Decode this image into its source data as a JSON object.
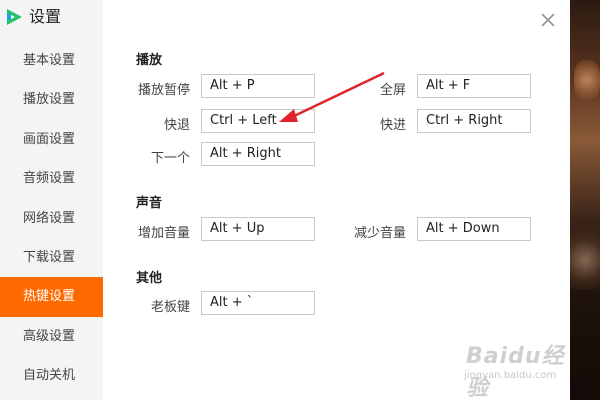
{
  "app": {
    "title": "设置"
  },
  "sidebar": {
    "items": [
      {
        "label": "基本设置",
        "active": false
      },
      {
        "label": "播放设置",
        "active": false
      },
      {
        "label": "画面设置",
        "active": false
      },
      {
        "label": "音频设置",
        "active": false
      },
      {
        "label": "网络设置",
        "active": false
      },
      {
        "label": "下载设置",
        "active": false
      },
      {
        "label": "热键设置",
        "active": true
      },
      {
        "label": "高级设置",
        "active": false
      },
      {
        "label": "自动关机",
        "active": false
      }
    ]
  },
  "sections": {
    "playback": {
      "title": "播放",
      "play_pause": {
        "label": "播放暂停",
        "value": "Alt + P"
      },
      "fullscreen": {
        "label": "全屏",
        "value": "Alt + F"
      },
      "rewind": {
        "label": "快退",
        "value": "Ctrl + Left"
      },
      "forward": {
        "label": "快进",
        "value": "Ctrl + Right"
      },
      "next": {
        "label": "下一个",
        "value": "Alt + Right"
      }
    },
    "sound": {
      "title": "声音",
      "volume_up": {
        "label": "增加音量",
        "value": "Alt + Up"
      },
      "volume_down": {
        "label": "减少音量",
        "value": "Alt + Down"
      }
    },
    "other": {
      "title": "其他",
      "boss_key": {
        "label": "老板键",
        "value": "Alt + `"
      }
    }
  },
  "watermark": {
    "main": "Baidu经验",
    "sub": "jingyan.baidu.com"
  },
  "colors": {
    "accent": "#ff6a00",
    "annotation_arrow": "#e0242b",
    "logo_green": "#25c26e",
    "logo_blue": "#1ea0e6"
  },
  "icons": {
    "logo": "tencent-video-logo-icon",
    "close": "close-icon"
  }
}
